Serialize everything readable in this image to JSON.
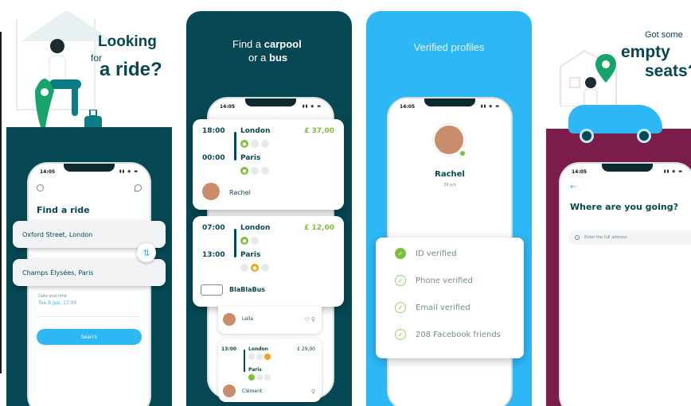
{
  "colors": {
    "teal": "#054752",
    "blue": "#2db7f5",
    "green": "#7bbf3a",
    "orange": "#f7a21b",
    "plum": "#7b1d4a"
  },
  "panel1": {
    "headline": {
      "line1": "Looking",
      "line2a": "for",
      "line2b": "a ride?"
    },
    "status_time": "14:05",
    "title": "Find a ride",
    "from": "Oxford Street, London",
    "to": "Champs Élysées, Paris",
    "date_label": "Date and time",
    "date_value": "Tue 8 jun, 17:00",
    "search_label": "Search"
  },
  "panel2": {
    "headline": {
      "line1a": "Find a",
      "line1b": "carpool",
      "line2a": "or a",
      "line2b": "bus"
    },
    "status_time": "14:05",
    "trip1": {
      "dep_time": "18:00",
      "dep_city": "London",
      "arr_time": "00:00",
      "arr_city": "Paris",
      "price": "£ 37,00",
      "driver": "Rachel"
    },
    "trip2": {
      "dep_time": "07:00",
      "dep_city": "London",
      "arr_time": "13:00",
      "arr_city": "Paris",
      "price": "£ 12,00",
      "operator": "BlaBlaBus"
    },
    "trip3": {
      "driver": "Leïla"
    },
    "trip4": {
      "dep_time": "13:00",
      "dep_city": "London",
      "arr_city": "Paris",
      "price": "£ 29,00",
      "driver": "Clément"
    }
  },
  "panel3": {
    "headline": "Verified profiles",
    "status_time": "14:05",
    "name": "Rachel",
    "age": "39 y/o",
    "checks": [
      "ID verified",
      "Phone verified",
      "Email verified",
      "208 Facebook friends"
    ]
  },
  "panel4": {
    "headline": {
      "line1": "Got some",
      "line2": "empty",
      "line3": "seats?"
    },
    "status_time": "14:05",
    "title": "Where are you going?",
    "placeholder": "Enter the full address"
  }
}
